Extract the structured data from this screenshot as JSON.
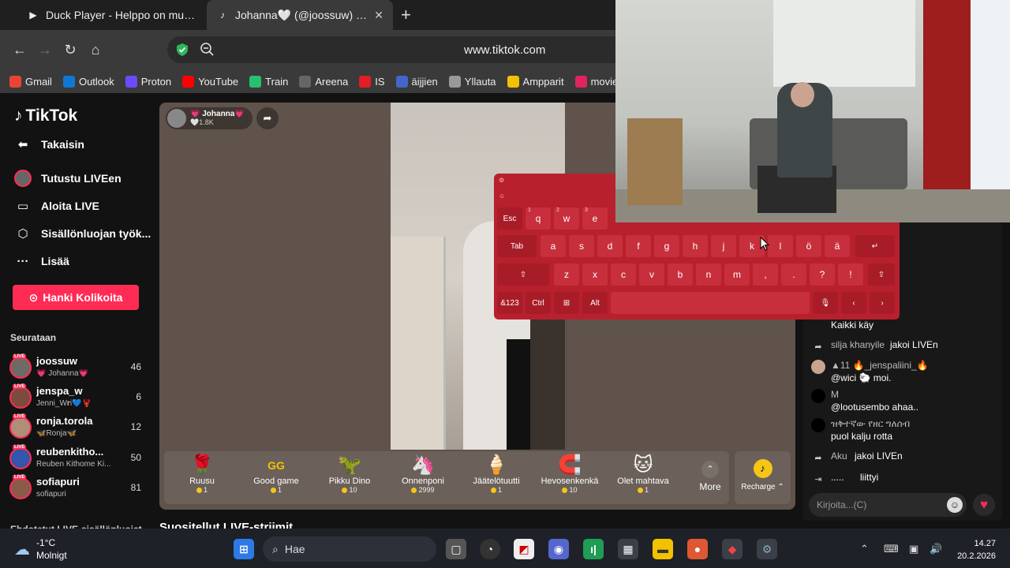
{
  "browser": {
    "tabs": [
      {
        "title": "Duck Player - Helppo on mun k",
        "icon": "duck-player-icon"
      },
      {
        "title": "Johanna🤍 (@joossuw) on",
        "icon": "tiktok-icon"
      }
    ],
    "url": "www.tiktok.com",
    "bookmarks": [
      {
        "label": "Gmail",
        "color": "#ea4335"
      },
      {
        "label": "Outlook",
        "color": "#0f78d4"
      },
      {
        "label": "Proton",
        "color": "#6d4aff"
      },
      {
        "label": "YouTube",
        "color": "#ff0000"
      },
      {
        "label": "Train",
        "color": "#25c16f"
      },
      {
        "label": "Areena",
        "color": "#666666"
      },
      {
        "label": "IS",
        "color": "#e31e24"
      },
      {
        "label": "äijjien",
        "color": "#4466cc"
      },
      {
        "label": "Yllauta",
        "color": "#999999"
      },
      {
        "label": "Ampparit",
        "color": "#f2c200"
      },
      {
        "label": "movies",
        "color": "#e0245e"
      }
    ]
  },
  "sidebar": {
    "logo": "TikTok",
    "back": "Takaisin",
    "nav": [
      "Tutustu LIVEen",
      "Aloita LIVE",
      "Sisällönluojan työk...",
      "Lisää"
    ],
    "coins_button": "Hanki Kolikoita",
    "following_title": "Seurataan",
    "following": [
      {
        "name": "joossuw",
        "sub": "💗 Johanna💗",
        "count": "46",
        "avatar": "#6e6a66",
        "live": "LIVE"
      },
      {
        "name": "jenspa_w",
        "sub": "Jenni_W𝐫i💙🦞",
        "count": "6",
        "avatar": "#7b4b3d",
        "live": "LIVE"
      },
      {
        "name": "ronja.torola",
        "sub": "🦋Ronja🦋",
        "count": "12",
        "avatar": "#b08f7a",
        "live": "LIVE"
      },
      {
        "name": "reubenkitho...",
        "sub": "Reuben Kithome Ki...",
        "count": "50",
        "avatar": "#3355aa",
        "live": "LIVE"
      },
      {
        "name": "sofiapuri",
        "sub": "sofiapuri",
        "count": "81",
        "avatar": "#8a5a4a",
        "live": "LIVE"
      }
    ],
    "cut_heading": "Ehdotetut LIVE-sisällönluojat"
  },
  "player": {
    "host_name": "💗 Johanna💗",
    "host_likes": "🤍1.8K",
    "gifts": [
      {
        "name": "Ruusu",
        "price": "1",
        "icon": "🌹"
      },
      {
        "name": "Good game",
        "price": "1",
        "icon": "GG"
      },
      {
        "name": "Pikku Dino",
        "price": "10",
        "icon": "🦖"
      },
      {
        "name": "Onnenponi",
        "price": "2999",
        "icon": "🦄"
      },
      {
        "name": "Jäätelötuutti",
        "price": "1",
        "icon": "🍦"
      },
      {
        "name": "Hevosenkenkä",
        "price": "10",
        "icon": "🧲"
      },
      {
        "name": "Olet mahtava",
        "price": "1",
        "icon": "🐱"
      }
    ],
    "more_label": "More",
    "recharge_label": "Recharge ⌃"
  },
  "recommended_heading": "Suositellut LIVE-striimit",
  "chat": {
    "messages": [
      {
        "icon": "",
        "name": "",
        "text": "Kaikki käy",
        "avatar": "#181818"
      },
      {
        "icon": "share-icon",
        "name": "silja khanyile",
        "text": "jakoi LIVEn",
        "avatar": ""
      },
      {
        "icon": "",
        "name": "▲11  🔥_jenspaliini_🔥",
        "text": "@wici 🐑 moi.",
        "avatar": "#c9a38f"
      },
      {
        "icon": "",
        "name": "M",
        "text": "@lootusembo ahaa..",
        "avatar": "#000000"
      },
      {
        "icon": "",
        "name": "ዝቅተኛው የዘር ግለሰብ",
        "text": "puol kalju rotta",
        "avatar": "#000000"
      },
      {
        "icon": "share-icon",
        "name": "Aku",
        "text": "jakoi LIVEn",
        "avatar": ""
      },
      {
        "icon": "join-icon",
        "name": ".....",
        "text": "liittyi",
        "avatar": ""
      }
    ],
    "placeholder": "Kirjoita...(C)"
  },
  "keyboard": {
    "rows": [
      [
        {
          "k": "Esc"
        },
        {
          "k": "q",
          "s": "1"
        },
        {
          "k": "w",
          "s": "2"
        },
        {
          "k": "e",
          "s": "3"
        }
      ],
      [
        {
          "k": "Tab"
        },
        {
          "k": "a"
        },
        {
          "k": "s"
        },
        {
          "k": "d"
        },
        {
          "k": "f"
        },
        {
          "k": "g"
        },
        {
          "k": "h"
        },
        {
          "k": "j"
        },
        {
          "k": "k"
        },
        {
          "k": "l"
        },
        {
          "k": "ö"
        },
        {
          "k": "ä"
        },
        {
          "k": "↵"
        }
      ],
      [
        {
          "k": "⇧"
        },
        {
          "k": "z"
        },
        {
          "k": "x"
        },
        {
          "k": "c"
        },
        {
          "k": "v"
        },
        {
          "k": "b"
        },
        {
          "k": "n"
        },
        {
          "k": "m"
        },
        {
          "k": ","
        },
        {
          "k": "."
        },
        {
          "k": "?"
        },
        {
          "k": "!"
        },
        {
          "k": "⇧"
        }
      ],
      [
        {
          "k": "&123"
        },
        {
          "k": "Ctrl"
        },
        {
          "k": "⊞"
        },
        {
          "k": "Alt"
        },
        {
          "k": " "
        },
        {
          "k": "🎙"
        },
        {
          "k": "‹"
        },
        {
          "k": "›"
        }
      ]
    ]
  },
  "taskbar": {
    "temperature": "-1°C",
    "condition": "Molnigt",
    "search": "Hae",
    "time": "14.27",
    "date": "20.2.2026"
  }
}
